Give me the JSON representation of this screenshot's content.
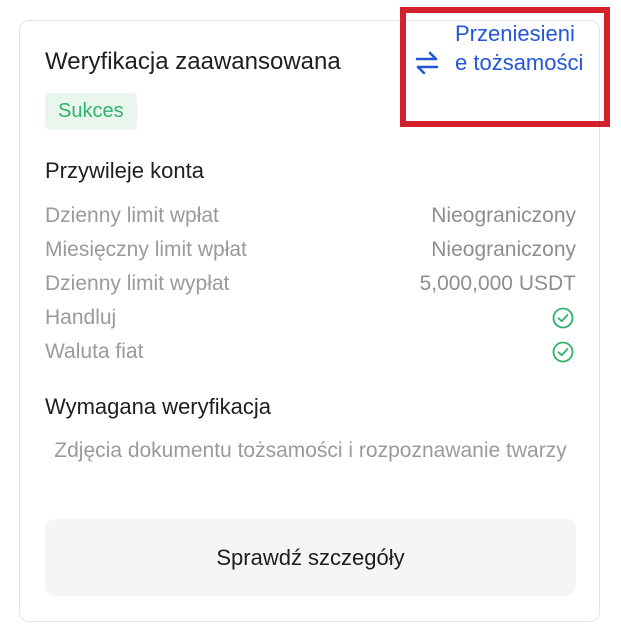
{
  "card": {
    "title": "Weryfikacja zaawansowana",
    "status_badge": "Sukces",
    "transfer_link": "Przeniesienie tożsamości"
  },
  "privileges": {
    "heading": "Przywileje konta",
    "rows": [
      {
        "label": "Dzienny limit wpłat",
        "value": "Nieograniczony"
      },
      {
        "label": "Miesięczny limit wpłat",
        "value": "Nieograniczony"
      },
      {
        "label": "Dzienny limit wypłat",
        "value": "5,000,000 USDT"
      },
      {
        "label": "Handluj",
        "icon": "check-circle-icon"
      },
      {
        "label": "Waluta fiat",
        "icon": "check-circle-icon"
      }
    ]
  },
  "requirements": {
    "heading": "Wymagana weryfikacja",
    "description": "Zdjęcia dokumentu tożsamości i rozpoznawanie twarzy"
  },
  "details_button": "Sprawdź szczegóły",
  "colors": {
    "accent_blue": "#2356d8",
    "success_green": "#2fb26c",
    "success_bg": "#e8f6ee",
    "highlight_red": "#d4202a"
  }
}
